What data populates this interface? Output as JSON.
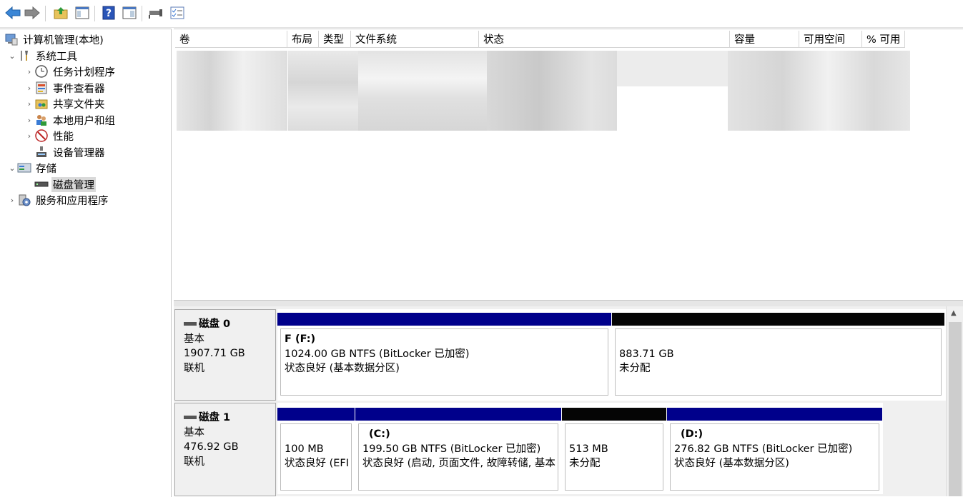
{
  "toolbar": {
    "icons": [
      "back-arrow-icon",
      "forward-arrow-icon",
      "up-folder-icon",
      "show-hide-tree-icon",
      "help-icon",
      "properties-icon",
      "connect-icon",
      "checklist-icon"
    ]
  },
  "tree": {
    "root": "计算机管理(本地)",
    "items": [
      {
        "label": "系统工具"
      },
      {
        "label": "任务计划程序"
      },
      {
        "label": "事件查看器"
      },
      {
        "label": "共享文件夹"
      },
      {
        "label": "本地用户和组"
      },
      {
        "label": "性能"
      },
      {
        "label": "设备管理器"
      },
      {
        "label": "存储"
      },
      {
        "label": "磁盘管理"
      },
      {
        "label": "服务和应用程序"
      }
    ]
  },
  "volume_list": {
    "columns": [
      "卷",
      "布局",
      "类型",
      "文件系统",
      "状态",
      "容量",
      "可用空间",
      "% 可用"
    ]
  },
  "disks": [
    {
      "name": "磁盘 0",
      "type": "基本",
      "size": "1907.71 GB",
      "status": "联机",
      "partitions": [
        {
          "name": "F  (F:)",
          "detail": "1024.00 GB NTFS (BitLocker 已加密)",
          "status": "状态良好 (基本数据分区)",
          "bar": "#00008b"
        },
        {
          "name": "",
          "detail": "883.71 GB",
          "status": "未分配",
          "bar": "#050505"
        }
      ]
    },
    {
      "name": "磁盘 1",
      "type": "基本",
      "size": "476.92 GB",
      "status": "联机",
      "partitions": [
        {
          "name": "",
          "detail": "100 MB",
          "status": "状态良好 (EFI",
          "bar": "#00008b"
        },
        {
          "name": "(C:)",
          "detail": "199.50 GB NTFS (BitLocker 已加密)",
          "status": "状态良好 (启动, 页面文件, 故障转储, 基本",
          "bar": "#00008b"
        },
        {
          "name": "",
          "detail": "513 MB",
          "status": "未分配",
          "bar": "#050505"
        },
        {
          "name": "(D:)",
          "detail": "276.82 GB NTFS (BitLocker 已加密)",
          "status": "状态良好 (基本数据分区)",
          "bar": "#00008b"
        }
      ]
    }
  ],
  "colors": {
    "primary_partition": "#00008b",
    "unallocated": "#050505"
  }
}
